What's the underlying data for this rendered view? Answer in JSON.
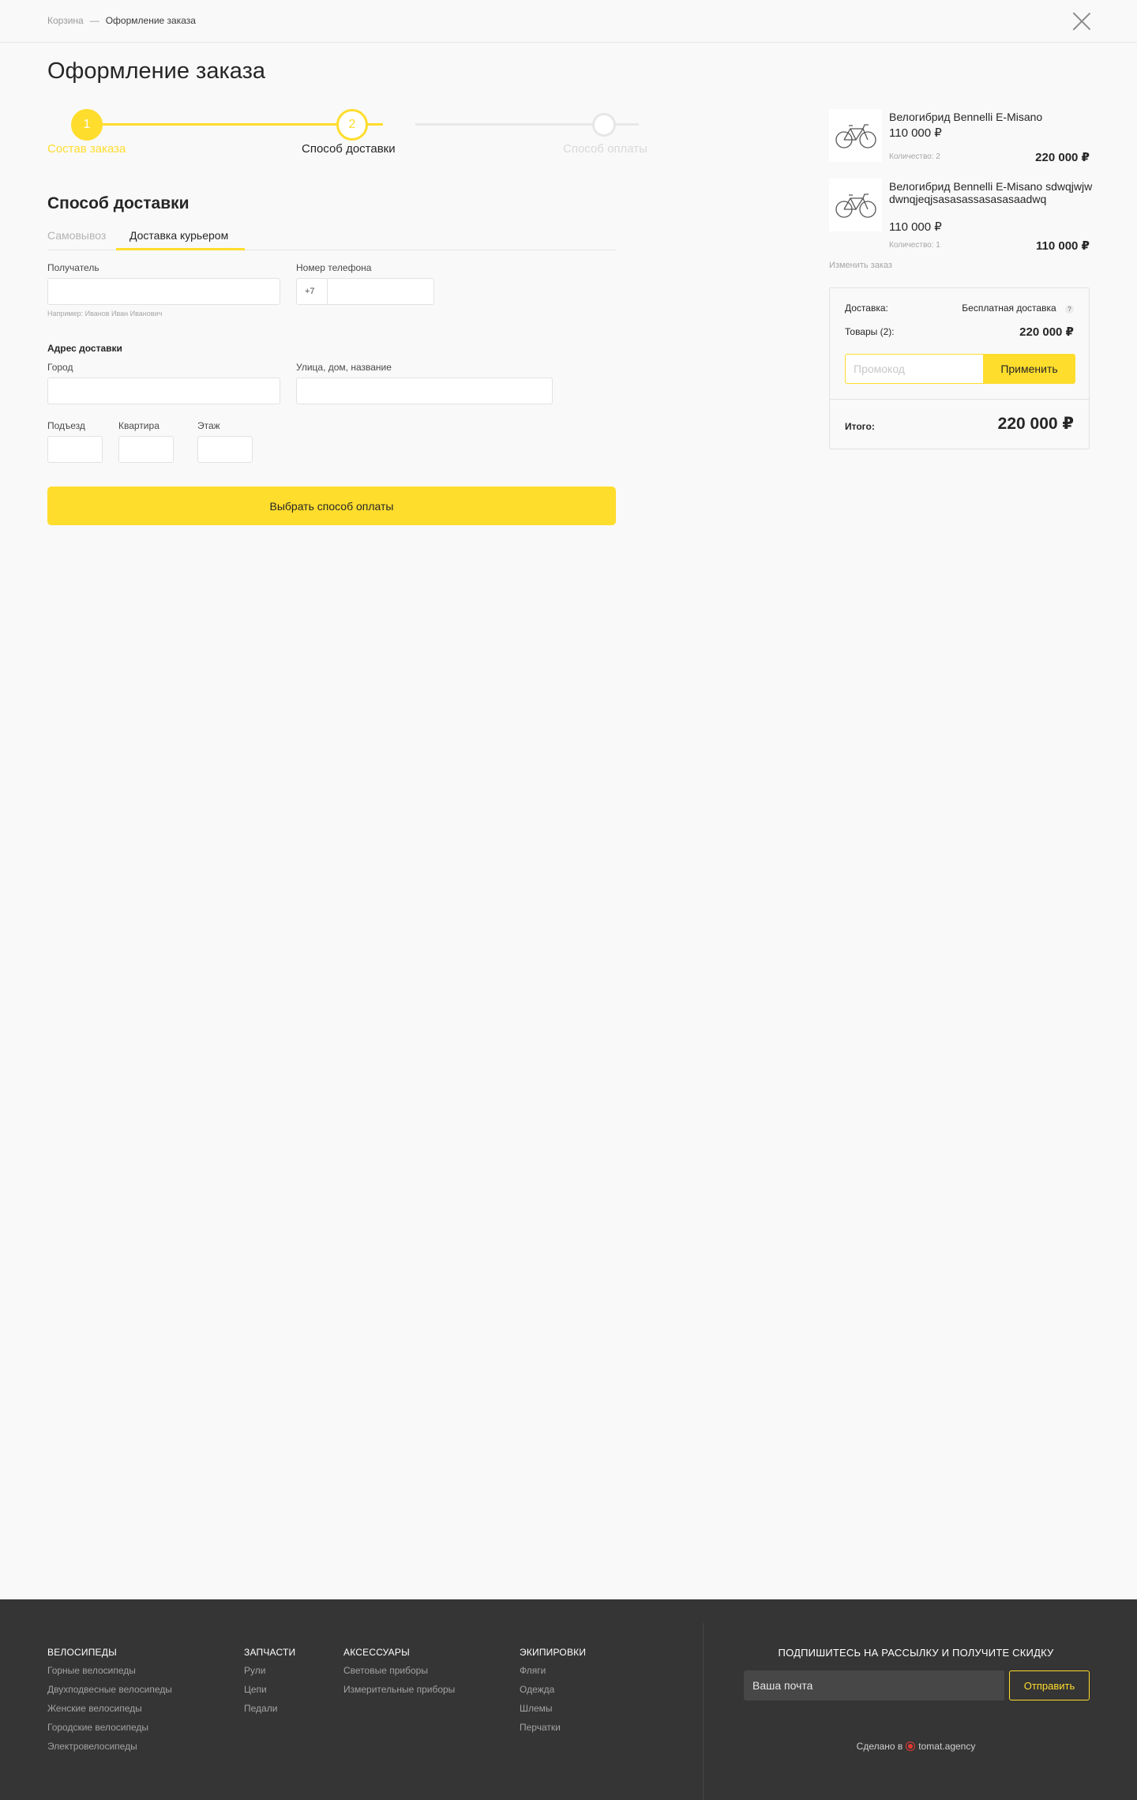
{
  "breadcrumb": {
    "items": [
      "Корзина",
      "—",
      "Оформление заказа"
    ]
  },
  "page": {
    "title": "Оформление заказа"
  },
  "stepper": {
    "steps": [
      {
        "number": "1",
        "label": "Состав заказа",
        "state": "done"
      },
      {
        "number": "2",
        "label": "Способ доставки",
        "state": "active"
      },
      {
        "number": "",
        "label": "Способ оплаты",
        "state": "todo"
      }
    ]
  },
  "delivery": {
    "title": "Способ доставки",
    "tabs": [
      "Самовывоз",
      "Доставка курьером"
    ],
    "active_tab": "Доставка курьером",
    "recipient_label": "Получатель",
    "recipient_value": "",
    "recipient_hint": "Например: Иванов Иван Иванович",
    "phone_label": "Номер телефона",
    "phone_prefix": "+7",
    "phone_value": "",
    "address_title": "Адрес доставки",
    "city_label": "Город",
    "city_value": "",
    "street_label": "Улица, дом, название",
    "street_value": "",
    "entrance_label": "Подъезд",
    "apartment_label": "Квартира",
    "floor_label": "Этаж",
    "submit_label": "Выбрать способ оплаты"
  },
  "cart": {
    "items": [
      {
        "name": "Велогибрид Bennelli E-Misano",
        "price": "110 000 ₽",
        "quantity": "Количество: 2",
        "total": "220 000 ₽"
      },
      {
        "name": "Велогибрид Bennelli E-Misano sdwqjwjwdwnqjeqjsasasassasasasaadwq",
        "price": "110 000 ₽",
        "quantity": "Количество: 1",
        "total": "110 000 ₽"
      }
    ],
    "change_order_label": "Изменить заказ"
  },
  "summary": {
    "delivery_label": "Доставка:",
    "delivery_value": "Бесплатная доставка",
    "delivery_help": "?",
    "goods_label": "Товары (2):",
    "goods_value": "220 000 ₽",
    "promo_placeholder": "Промокод",
    "promo_button": "Применить",
    "total_label": "Итого:",
    "total_value": "220 000 ₽"
  },
  "footer": {
    "columns": [
      {
        "title": "ВЕЛОСИПЕДЫ",
        "links": [
          "Горные велосипеды",
          "Двухподвесные велосипеды",
          "Женские велосипеды",
          "Городские велосипеды",
          "Электровелосипеды"
        ]
      },
      {
        "title": "ЗАПЧАСТИ",
        "links": [
          "Рули",
          "Цепи",
          "Педали"
        ]
      },
      {
        "title": "АКСЕССУАРЫ",
        "links": [
          "Световые приборы",
          "Измерительные приборы"
        ]
      },
      {
        "title": "ЭКИПИРОВКИ",
        "links": [
          "Фляги",
          "Одежда",
          "Шлемы",
          "Перчатки"
        ]
      }
    ],
    "subscribe_title": "ПОДПИШИТЕСЬ НА РАССЫЛКУ И ПОЛУЧИТЕ СКИДКУ",
    "subscribe_placeholder": "Ваша почта",
    "subscribe_button": "Отправить",
    "made_by_prefix": "Сделано в",
    "made_by_agency": "tomat.agency"
  },
  "colors": {
    "accent": "#ffdd2d",
    "footer_bg": "#353535",
    "page_bg": "#f9f9f9"
  },
  "icons": {
    "close": "close-icon",
    "bike": "bicycle-icon",
    "agency_logo": "tomat-logo-icon"
  }
}
